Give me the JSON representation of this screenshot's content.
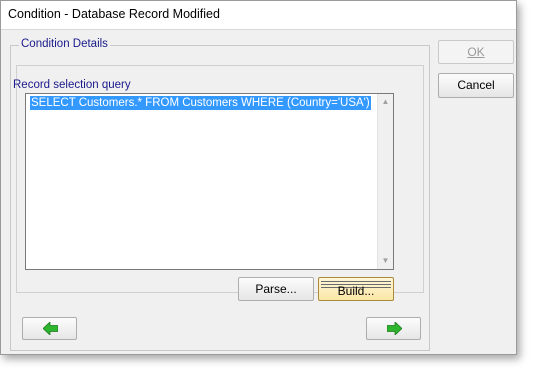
{
  "window": {
    "title": "Condition - Database Record Modified"
  },
  "group": {
    "legend": "Condition Details",
    "field_label": "Record selection query",
    "query_text": "SELECT Customers.* FROM Customers WHERE (Country='USA')"
  },
  "buttons": {
    "parse_label": "Parse...",
    "build_label": "Build...",
    "ok_label": "OK",
    "ok_enabled": false,
    "cancel_label": "Cancel"
  },
  "nav": {
    "back_icon": "left-arrow-icon",
    "next_icon": "right-arrow-icon"
  },
  "colors": {
    "label_blue": "#1a1a8c",
    "selection": "#3399ff",
    "arrow_green": "#2db52d"
  }
}
